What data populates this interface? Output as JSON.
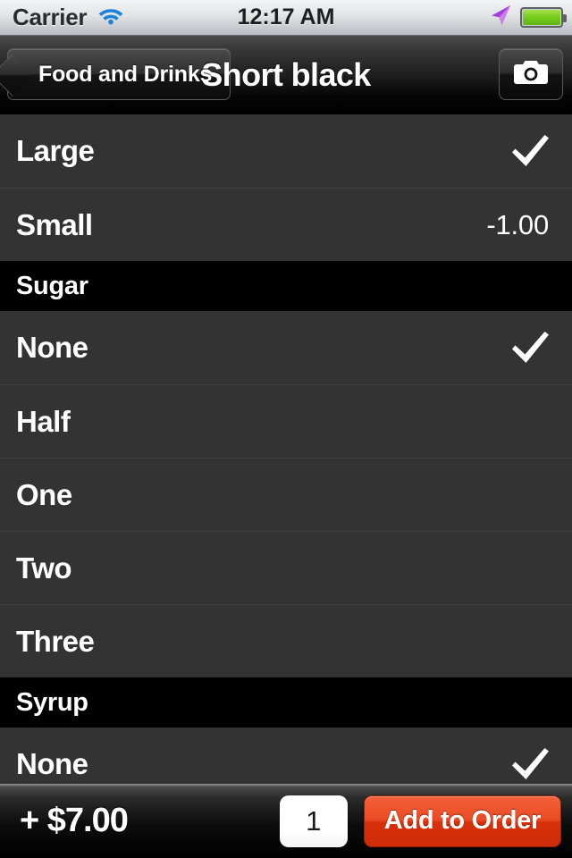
{
  "status_bar": {
    "carrier": "Carrier",
    "time": "12:17 AM",
    "wifi_icon": "wifi-icon",
    "location_icon": "location-arrow-icon",
    "battery_icon": "battery-full-icon",
    "wifi_color": "#1d82dc",
    "location_color": "#b14ae0",
    "battery_color": "#79cc20"
  },
  "nav_bar": {
    "back_label": "Food and Drinks",
    "title": "Short black",
    "camera_icon": "camera-icon"
  },
  "list": [
    {
      "kind": "row",
      "label": "Large",
      "value": "",
      "checked": true
    },
    {
      "kind": "row",
      "label": "Small",
      "value": "-1.00",
      "checked": false
    },
    {
      "kind": "header",
      "label": "Sugar"
    },
    {
      "kind": "row",
      "label": "None",
      "value": "",
      "checked": true
    },
    {
      "kind": "row",
      "label": "Half",
      "value": "",
      "checked": false
    },
    {
      "kind": "row",
      "label": "One",
      "value": "",
      "checked": false
    },
    {
      "kind": "row",
      "label": "Two",
      "value": "",
      "checked": false
    },
    {
      "kind": "row",
      "label": "Three",
      "value": "",
      "checked": false
    },
    {
      "kind": "header",
      "label": "Syrup"
    },
    {
      "kind": "row",
      "label": "None",
      "value": "",
      "checked": true
    }
  ],
  "toolbar": {
    "price_total": "+ $7.00",
    "quantity": "1",
    "add_label": "Add to Order",
    "add_button_color": "#e04020"
  }
}
